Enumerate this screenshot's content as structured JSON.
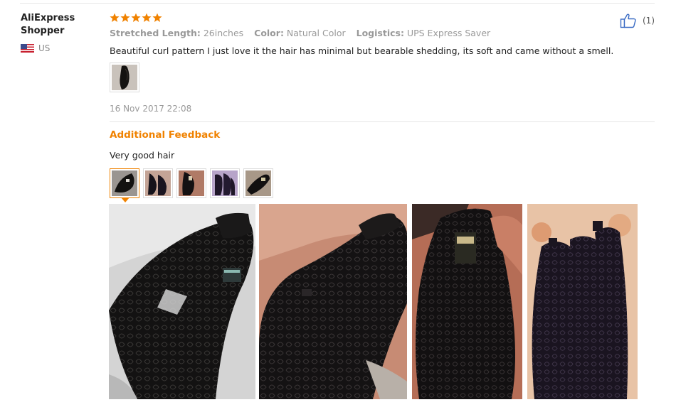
{
  "buyer": {
    "name": "AliExpress Shopper",
    "country": "US",
    "flag_icon": "us-flag-icon"
  },
  "review": {
    "rating": 5,
    "rating_max": 5,
    "star_color": "#f08200",
    "meta": {
      "stretched_length_label": "Stretched Length:",
      "stretched_length_value": "26inches",
      "color_label": "Color:",
      "color_value": "Natural Color",
      "logistics_label": "Logistics:",
      "logistics_value": "UPS Express Saver"
    },
    "text": "Beautiful curl pattern I just love it the hair has minimal but bearable shedding, its soft and came without a smell.",
    "date": "16 Nov 2017 22:08"
  },
  "helpful": {
    "icon": "thumbs-up-icon",
    "count": "(1)"
  },
  "additional": {
    "title": "Additional Feedback",
    "text": "Very good hair",
    "accent_color": "#f08200",
    "selected_thumbnail": 1,
    "thumbnail_count": 5
  }
}
